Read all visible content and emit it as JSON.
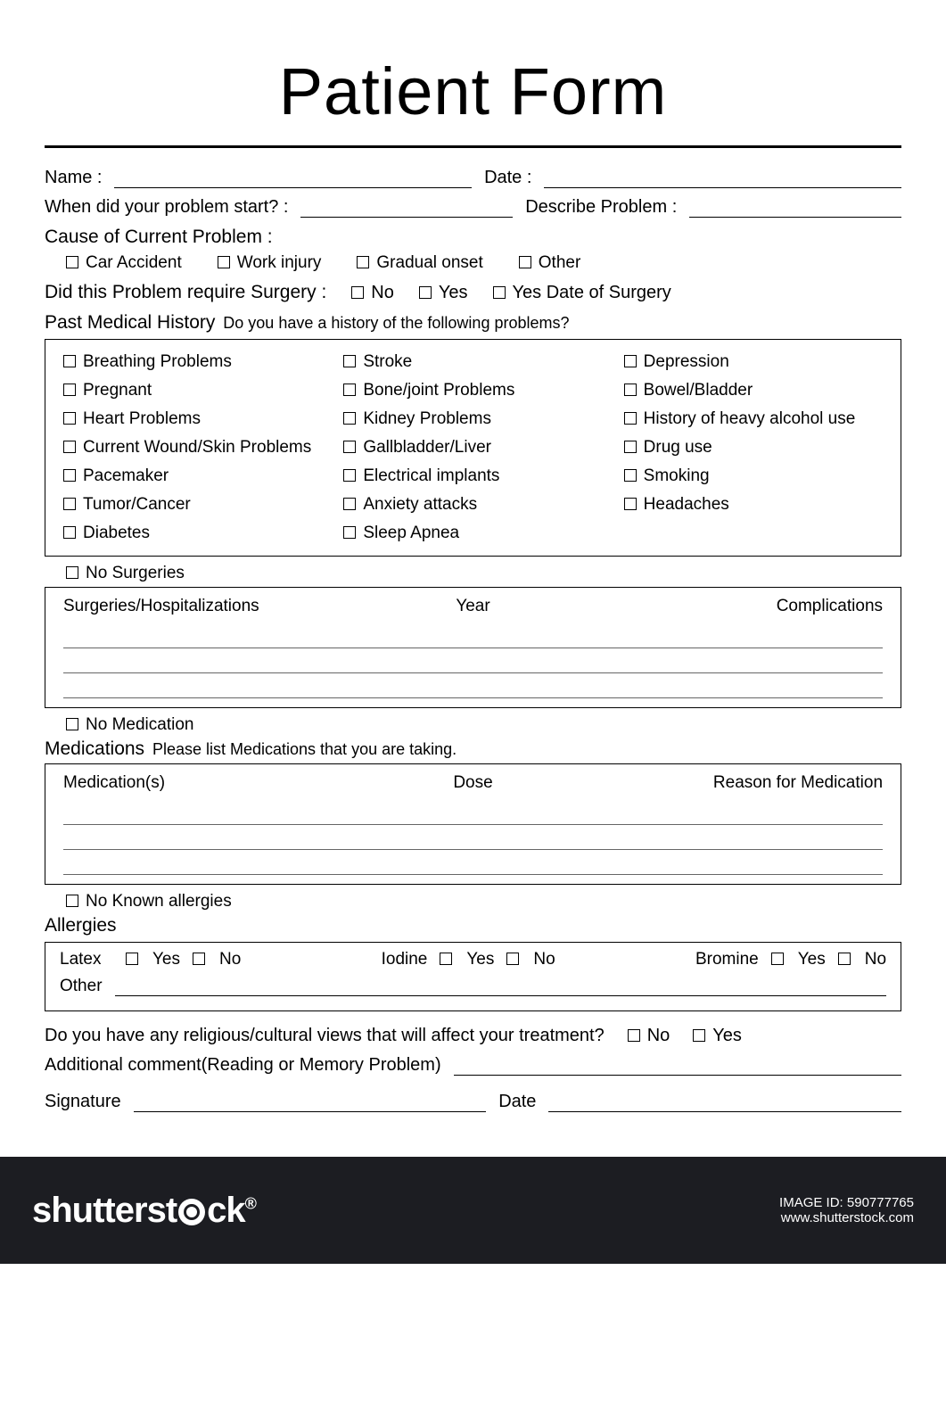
{
  "title": "Patient Form",
  "fields": {
    "name": "Name :",
    "date": "Date :",
    "problem_start": "When did your problem start? :",
    "describe_problem": "Describe Problem :",
    "cause_head": "Cause of Current Problem :",
    "surgery_q": "Did this Problem require Surgery :",
    "pmh_head": "Past Medical History",
    "pmh_sub": "Do you have a history of the following problems?",
    "no_surgeries": "No Surgeries",
    "no_medication": "No Medication",
    "meds_head": "Medications",
    "meds_sub": "Please list Medications that you are taking.",
    "no_allergies": "No Known allergies",
    "allergies_head": "Allergies",
    "religious_q": "Do you have any religious/cultural views that will affect your treatment?",
    "addl_comment": "Additional comment(Reading or Memory Problem)",
    "signature": "Signature",
    "sig_date": "Date"
  },
  "cause_options": [
    "Car Accident",
    "Work injury",
    "Gradual onset",
    "Other"
  ],
  "surgery_options": [
    "No",
    "Yes",
    "Yes Date of Surgery"
  ],
  "history": {
    "col1": [
      "Breathing Problems",
      "Pregnant",
      "Heart Problems",
      "Current Wound/Skin Problems",
      "Pacemaker",
      "Tumor/Cancer",
      "Diabetes"
    ],
    "col2": [
      "Stroke",
      "Bone/joint Problems",
      "Kidney Problems",
      "Gallbladder/Liver",
      "Electrical implants",
      "Anxiety attacks",
      "Sleep Apnea"
    ],
    "col3": [
      "Depression",
      "Bowel/Bladder",
      "History of heavy alcohol use",
      "Drug use",
      "Smoking",
      "Headaches"
    ]
  },
  "surg_tbl": {
    "c1": "Surgeries/Hospitalizations",
    "c2": "Year",
    "c3": "Complications"
  },
  "med_tbl": {
    "c1": "Medication(s)",
    "c2": "Dose",
    "c3": "Reason for Medication"
  },
  "allergies": {
    "latex": "Latex",
    "iodine": "Iodine",
    "bromine": "Bromine",
    "other": "Other",
    "yes": "Yes",
    "no": "No"
  },
  "yesno": {
    "no": "No",
    "yes": "Yes"
  },
  "footer": {
    "brand": "shutterstck",
    "image_id_label": "IMAGE ID:",
    "image_id": "590777765",
    "site": "www.shutterstock.com"
  }
}
